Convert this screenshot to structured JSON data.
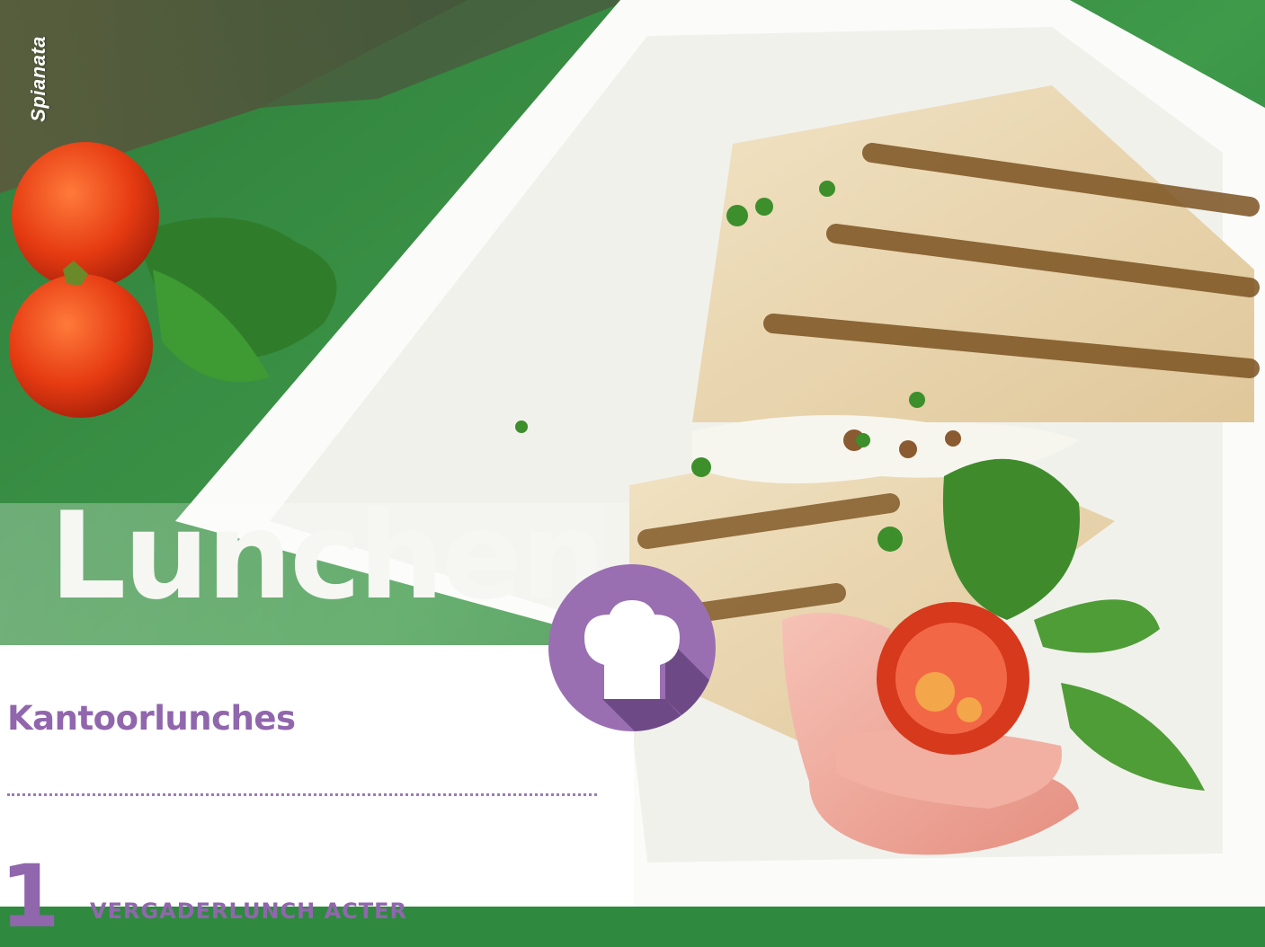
{
  "photo": {
    "caption": "Spianata"
  },
  "page": {
    "title": "Lunchen",
    "subtitle": "Kantoorlunches",
    "step_number": "1",
    "step_heading": "VERGADERLUNCH ACTER"
  },
  "badge": {
    "icon": "chef-hat-icon",
    "color": "#9a6fb2",
    "shadow_color": "#6d4a86"
  },
  "colors": {
    "accent": "#9066ad",
    "table_green": "#2f8a3f"
  }
}
